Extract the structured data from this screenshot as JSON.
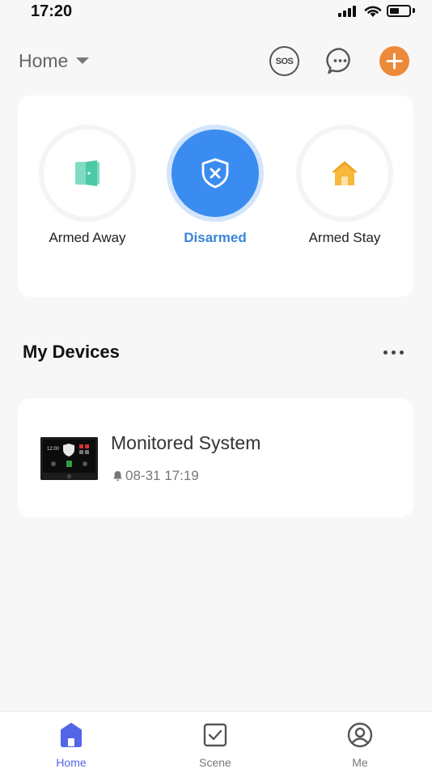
{
  "status_bar": {
    "time": "17:20"
  },
  "header": {
    "home_title": "Home",
    "sos_label": "SOS",
    "icons": {
      "dropdown": "chevron-down-icon",
      "sos": "sos-icon",
      "message": "chat-bubble-icon",
      "add": "plus-icon"
    },
    "accent_color": "#ec8a3a"
  },
  "modes": [
    {
      "label": "Armed Away",
      "icon": "door-exit-icon",
      "selected": false
    },
    {
      "label": "Disarmed",
      "icon": "shield-x-icon",
      "selected": true
    },
    {
      "label": "Armed Stay",
      "icon": "house-icon",
      "selected": false
    }
  ],
  "devices_section": {
    "title": "My Devices",
    "more_icon": "more-horizontal-icon"
  },
  "devices": [
    {
      "name": "Monitored System",
      "last_event": "08-31 17:19",
      "event_icon": "bell-icon",
      "thumbnail_time": "12:00"
    }
  ],
  "tab_bar": {
    "tabs": [
      {
        "label": "Home",
        "icon": "home-icon",
        "active": true
      },
      {
        "label": "Scene",
        "icon": "checkbox-icon",
        "active": false
      },
      {
        "label": "Me",
        "icon": "user-circle-icon",
        "active": false
      }
    ],
    "active_color": "#5266e8"
  }
}
